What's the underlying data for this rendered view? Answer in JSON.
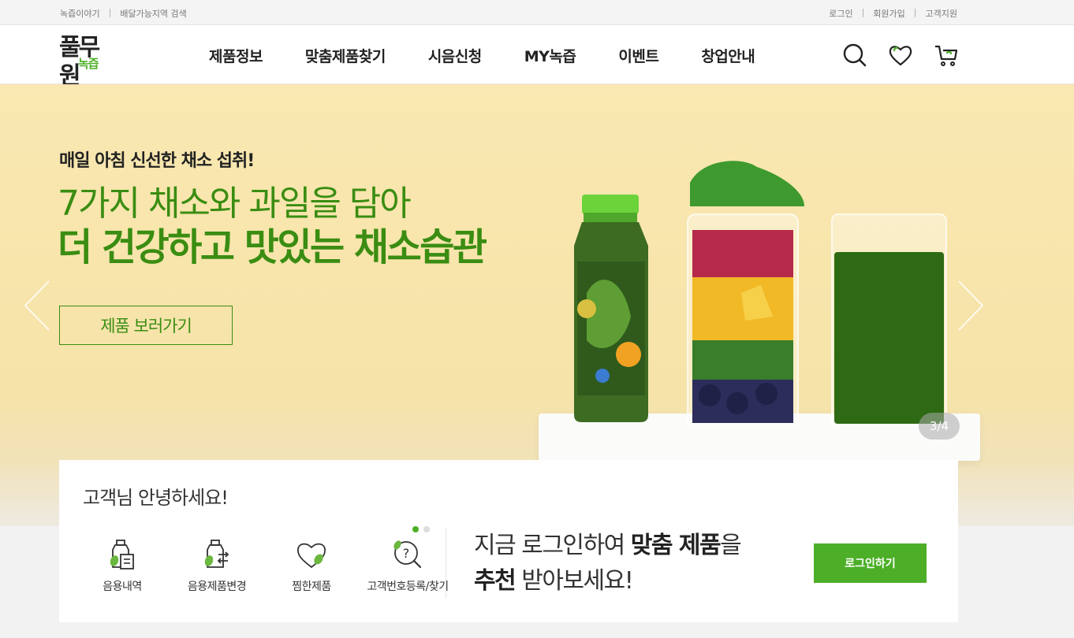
{
  "topbar": {
    "left_links": [
      "녹즙이야기",
      "배달가능지역 검색"
    ],
    "right_links": [
      "로그인",
      "회원가입",
      "고객지원"
    ]
  },
  "header": {
    "logo_main": "풀무원",
    "logo_sub": "녹즙",
    "nav": [
      "제품정보",
      "맞춤제품찾기",
      "시음신청",
      "MY녹즙",
      "이벤트",
      "창업안내"
    ],
    "icons": [
      "search-icon",
      "heart-icon",
      "cart-icon"
    ]
  },
  "hero": {
    "subtitle": "매일 아침 신선한 채소 섭취!",
    "title_line1": "7가지 채소와 과일을 담아",
    "title_line2": "더 건강하고 맛있는 채소습관",
    "cta_label": "제품 보러가기",
    "pager": "3/4",
    "slide_current": 3,
    "slide_total": 4,
    "accent_color": "#3a8d12"
  },
  "quick": {
    "greeting": "고객님 안녕하세요!",
    "items": [
      {
        "label": "음용내역",
        "icon": "drink-history-icon"
      },
      {
        "label": "음용제품변경",
        "icon": "product-change-icon"
      },
      {
        "label": "찜한제품",
        "icon": "wishlist-icon"
      },
      {
        "label": "고객번호등록/찾기",
        "icon": "customer-number-icon"
      }
    ],
    "page_dots": 2,
    "message_pre": "지금 로그인하여 ",
    "message_bold1": "맞춤 제품",
    "message_mid": "을",
    "message_bold2": "추천",
    "message_post": " 받아보세요!",
    "login_label": "로그인하기",
    "brand_green": "#4caf27"
  }
}
